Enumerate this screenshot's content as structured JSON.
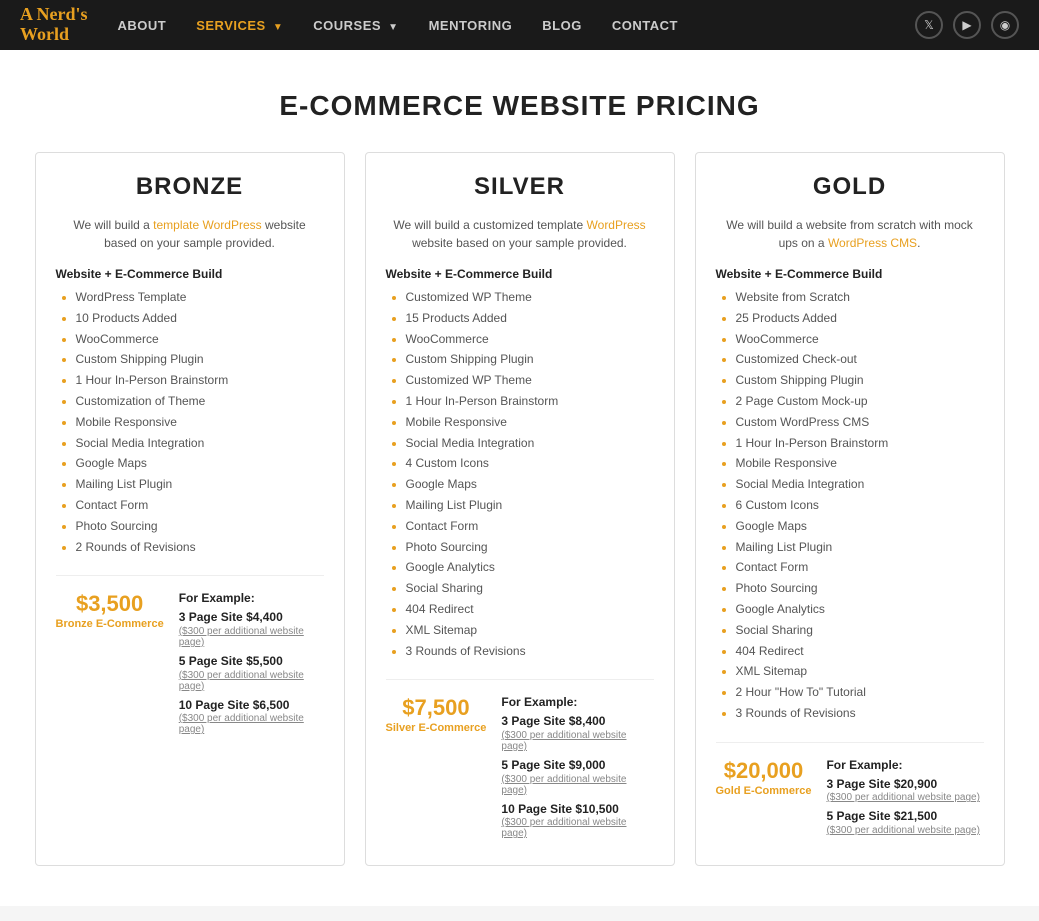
{
  "nav": {
    "logo_line1": "A Nerd's",
    "logo_line2": "World",
    "links": [
      {
        "label": "ABOUT",
        "active": false
      },
      {
        "label": "SERVICES",
        "active": true,
        "has_arrow": true
      },
      {
        "label": "COURSES",
        "active": false,
        "has_arrow": true
      },
      {
        "label": "MENTORING",
        "active": false
      },
      {
        "label": "BLOG",
        "active": false
      },
      {
        "label": "CONTACT",
        "active": false
      }
    ],
    "social": [
      "twitter",
      "youtube",
      "instagram"
    ]
  },
  "page": {
    "title": "E-COMMERCE WEBSITE PRICING"
  },
  "plans": [
    {
      "name": "BRONZE",
      "desc_parts": [
        "We will build a ",
        "template WordPress",
        " website based on your sample provided."
      ],
      "section_heading": "Website + E-Commerce Build",
      "features": [
        "WordPress Template",
        "10 Products Added",
        "WooCommerce",
        "Custom Shipping Plugin",
        "1 Hour In-Person Brainstorm",
        "Customization of Theme",
        "Mobile Responsive",
        "Social Media Integration",
        "Google Maps",
        "Mailing List Plugin",
        "Contact Form",
        "Photo Sourcing",
        "2 Rounds of Revisions"
      ],
      "footer_example_label": "For Example:",
      "footer_rows": [
        {
          "label": "3 Page Site $4,400",
          "sub": "($300 per additional website page)"
        },
        {
          "label": "5 Page Site $5,500",
          "sub": "($300 per additional website page)"
        },
        {
          "label": "10 Page Site $6,500",
          "sub": "($300 per additional website page)"
        }
      ],
      "price": "$3,500",
      "price_label": "Bronze E-Commerce"
    },
    {
      "name": "SILVER",
      "desc_parts": [
        "We will build a customized template ",
        "WordPress",
        " website based on your sample provided."
      ],
      "section_heading": "Website + E-Commerce Build",
      "features": [
        "Customized WP Theme",
        "15 Products Added",
        "WooCommerce",
        "Custom Shipping Plugin",
        "Customized WP Theme",
        "1 Hour In-Person Brainstorm",
        "Mobile Responsive",
        "Social Media Integration",
        "4 Custom Icons",
        "Google Maps",
        "Mailing List Plugin",
        "Contact Form",
        "Photo Sourcing",
        "Google Analytics",
        "Social Sharing",
        "404 Redirect",
        "XML Sitemap",
        "3 Rounds of Revisions"
      ],
      "footer_example_label": "For Example:",
      "footer_rows": [
        {
          "label": "3 Page Site $8,400",
          "sub": "($300 per additional website page)"
        },
        {
          "label": "5 Page Site $9,000",
          "sub": "($300 per additional website page)"
        },
        {
          "label": "10 Page Site $10,500",
          "sub": "($300 per additional website page)"
        }
      ],
      "price": "$7,500",
      "price_label": "Silver E-Commerce"
    },
    {
      "name": "GOLD",
      "desc_parts": [
        "We will build a website from scratch with mock ups on a ",
        "WordPress CMS",
        "."
      ],
      "section_heading": "Website + E-Commerce Build",
      "features": [
        "Website from Scratch",
        "25 Products Added",
        "WooCommerce",
        "Customized Check-out",
        "Custom Shipping Plugin",
        "2 Page Custom Mock-up",
        "Custom WordPress CMS",
        "1 Hour In-Person Brainstorm",
        "Mobile Responsive",
        "Social Media Integration",
        "6 Custom Icons",
        "Google Maps",
        "Mailing List Plugin",
        "Contact Form",
        "Photo Sourcing",
        "Google Analytics",
        "Social Sharing",
        "404 Redirect",
        "XML Sitemap",
        "2 Hour \"How To\" Tutorial",
        "3 Rounds of Revisions"
      ],
      "footer_example_label": "For Example:",
      "footer_rows": [
        {
          "label": "3 Page Site $20,900",
          "sub": "($300 per additional website page)"
        },
        {
          "label": "5 Page Site $21,500",
          "sub": "($300 per additional website page)"
        }
      ],
      "price": "$20,000",
      "price_label": "Gold E-Commerce"
    }
  ]
}
